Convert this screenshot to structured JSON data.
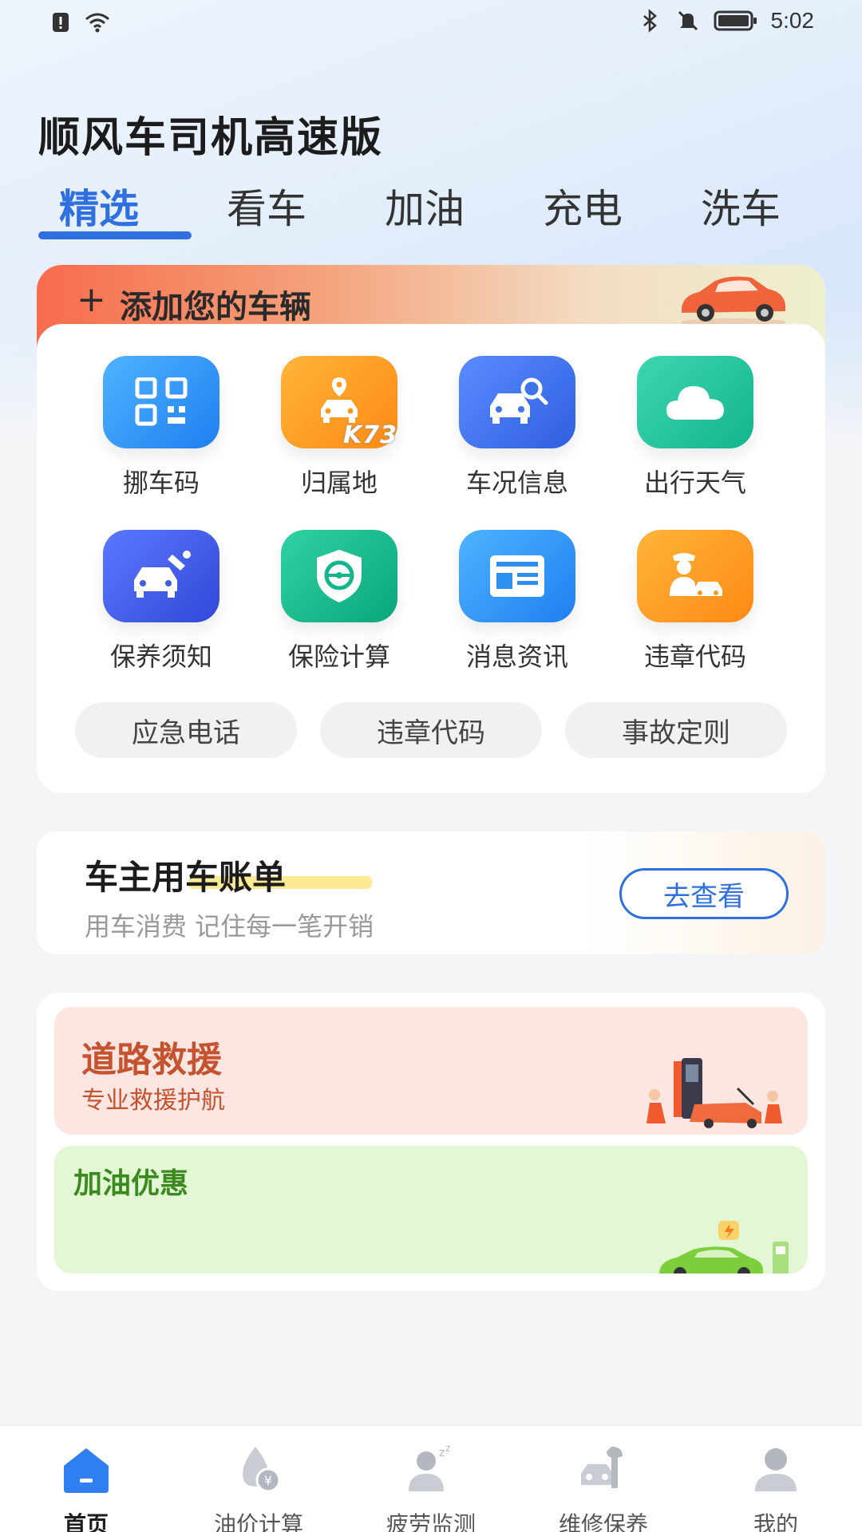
{
  "status_bar": {
    "time": "5:02",
    "left_icons": [
      "alert-icon",
      "wifi-icon"
    ],
    "right_icons": [
      "bluetooth-icon",
      "mute-icon",
      "battery-icon"
    ]
  },
  "app_title": "顺风车司机高速版",
  "tabs": [
    {
      "label": "精选",
      "active": true
    },
    {
      "label": "看车",
      "active": false
    },
    {
      "label": "加油",
      "active": false
    },
    {
      "label": "充电",
      "active": false
    },
    {
      "label": "洗车",
      "active": false
    }
  ],
  "add_vehicle": {
    "plus": "+",
    "label": "添加您的车辆"
  },
  "services": [
    {
      "label": "挪车码",
      "icon": "qr-code-icon",
      "color": "#2f8ff0"
    },
    {
      "label": "归属地",
      "icon": "car-location-icon",
      "color": "#ff9a1f"
    },
    {
      "label": "车况信息",
      "icon": "car-search-icon",
      "color": "#3f73ea"
    },
    {
      "label": "出行天气",
      "icon": "cloud-icon",
      "color": "#1fbf9a"
    },
    {
      "label": "保养须知",
      "icon": "car-maintenance-icon",
      "color": "#3f5ee0"
    },
    {
      "label": "保险计算",
      "icon": "insurance-shield-icon",
      "color": "#14b58c"
    },
    {
      "label": "消息资讯",
      "icon": "news-icon",
      "color": "#2f8ff0"
    },
    {
      "label": "违章代码",
      "icon": "traffic-police-icon",
      "color": "#ff9a1f"
    }
  ],
  "quick_pills": [
    "应急电话",
    "违章代码",
    "事故定则"
  ],
  "watermark": "K73",
  "bill": {
    "title": "车主用车账单",
    "subtitle": "用车消费 记住每一笔开销",
    "button": "去查看"
  },
  "rescue": {
    "title": "道路救援",
    "subtitle": "专业救援护航"
  },
  "fuel_promo": {
    "title": "加油优惠"
  },
  "bottom_nav": [
    {
      "label": "首页",
      "icon": "home-icon",
      "active": true
    },
    {
      "label": "油价计算",
      "icon": "oil-price-icon",
      "active": false
    },
    {
      "label": "疲劳监测",
      "icon": "fatigue-icon",
      "active": false
    },
    {
      "label": "维修保养",
      "icon": "repair-icon",
      "active": false
    },
    {
      "label": "我的",
      "icon": "profile-icon",
      "active": false
    }
  ]
}
